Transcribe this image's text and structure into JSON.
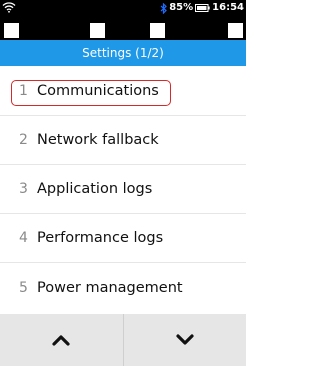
{
  "status_bar": {
    "battery_percent": "85%",
    "time": "16:54"
  },
  "header": {
    "title": "Settings (1/2)"
  },
  "menu": {
    "items": [
      {
        "number": "1",
        "label": "Communications",
        "selected": true
      },
      {
        "number": "2",
        "label": "Network fallback",
        "selected": false
      },
      {
        "number": "3",
        "label": "Application logs",
        "selected": false
      },
      {
        "number": "4",
        "label": "Performance logs",
        "selected": false
      },
      {
        "number": "5",
        "label": "Power management",
        "selected": false
      }
    ]
  },
  "nav": {
    "up_icon": "chevron-up-icon",
    "down_icon": "chevron-down-icon"
  },
  "colors": {
    "header_bg": "#1f98e8",
    "selection_border": "#d42a2a",
    "status_bar_bg": "#000000",
    "nav_bg": "#e6e6e6"
  }
}
